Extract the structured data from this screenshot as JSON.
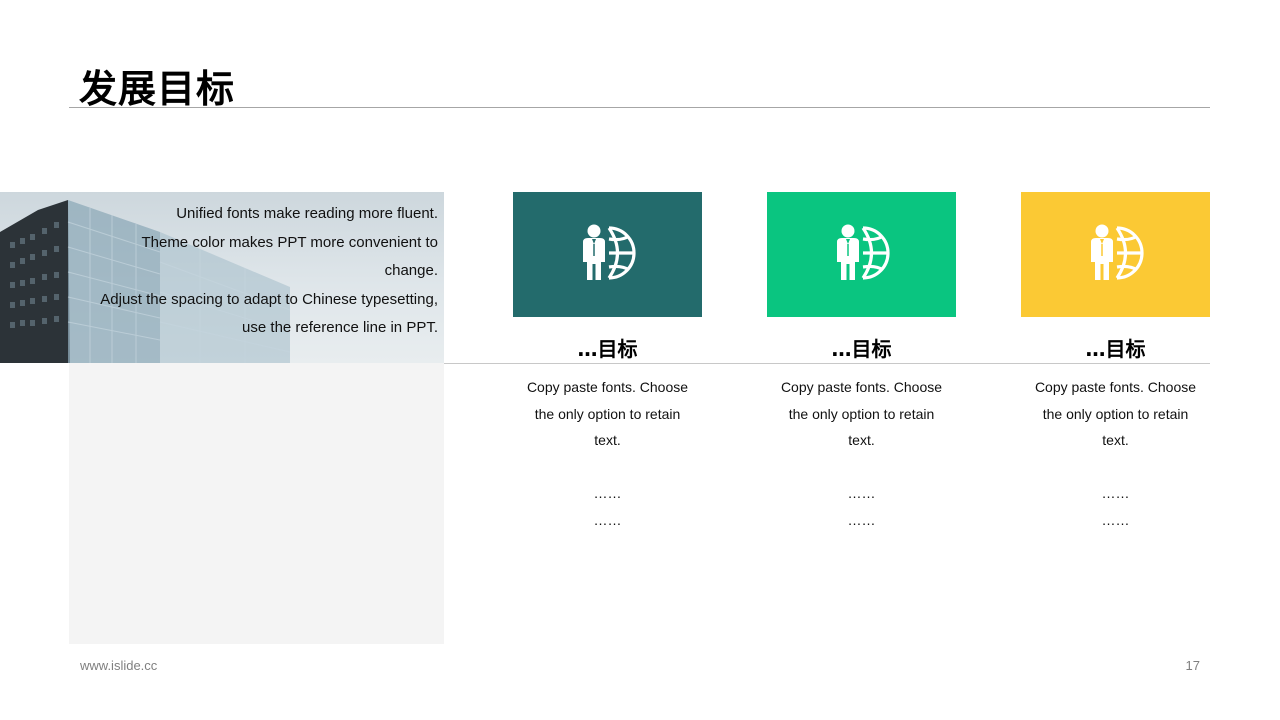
{
  "slide": {
    "title": "发展目标",
    "intro_lines": [
      "Unified fonts make reading more fluent.",
      "Theme color makes PPT more convenient to",
      "change.",
      "Adjust the spacing to adapt to Chinese typesetting,",
      "use the reference line in PPT."
    ],
    "cards": [
      {
        "color": "#236b6c",
        "icon": "businessman-globe-icon",
        "title": "…目标",
        "text_lines": [
          "Copy paste fonts. Choose",
          "the only option to retain",
          "text."
        ],
        "extra_lines": [
          "……",
          "……"
        ]
      },
      {
        "color": "#0ac580",
        "icon": "businessman-globe-icon",
        "title": "…目标",
        "text_lines": [
          "Copy paste fonts. Choose",
          "the only option to retain",
          "text."
        ],
        "extra_lines": [
          "……",
          "……"
        ]
      },
      {
        "color": "#fbc934",
        "icon": "businessman-globe-icon",
        "title": "…目标",
        "text_lines": [
          "Copy paste fonts. Choose",
          "the only option to retain",
          "text."
        ],
        "extra_lines": [
          "……",
          "……"
        ]
      }
    ],
    "footer_url": "www.islide.cc",
    "page_number": "17"
  }
}
